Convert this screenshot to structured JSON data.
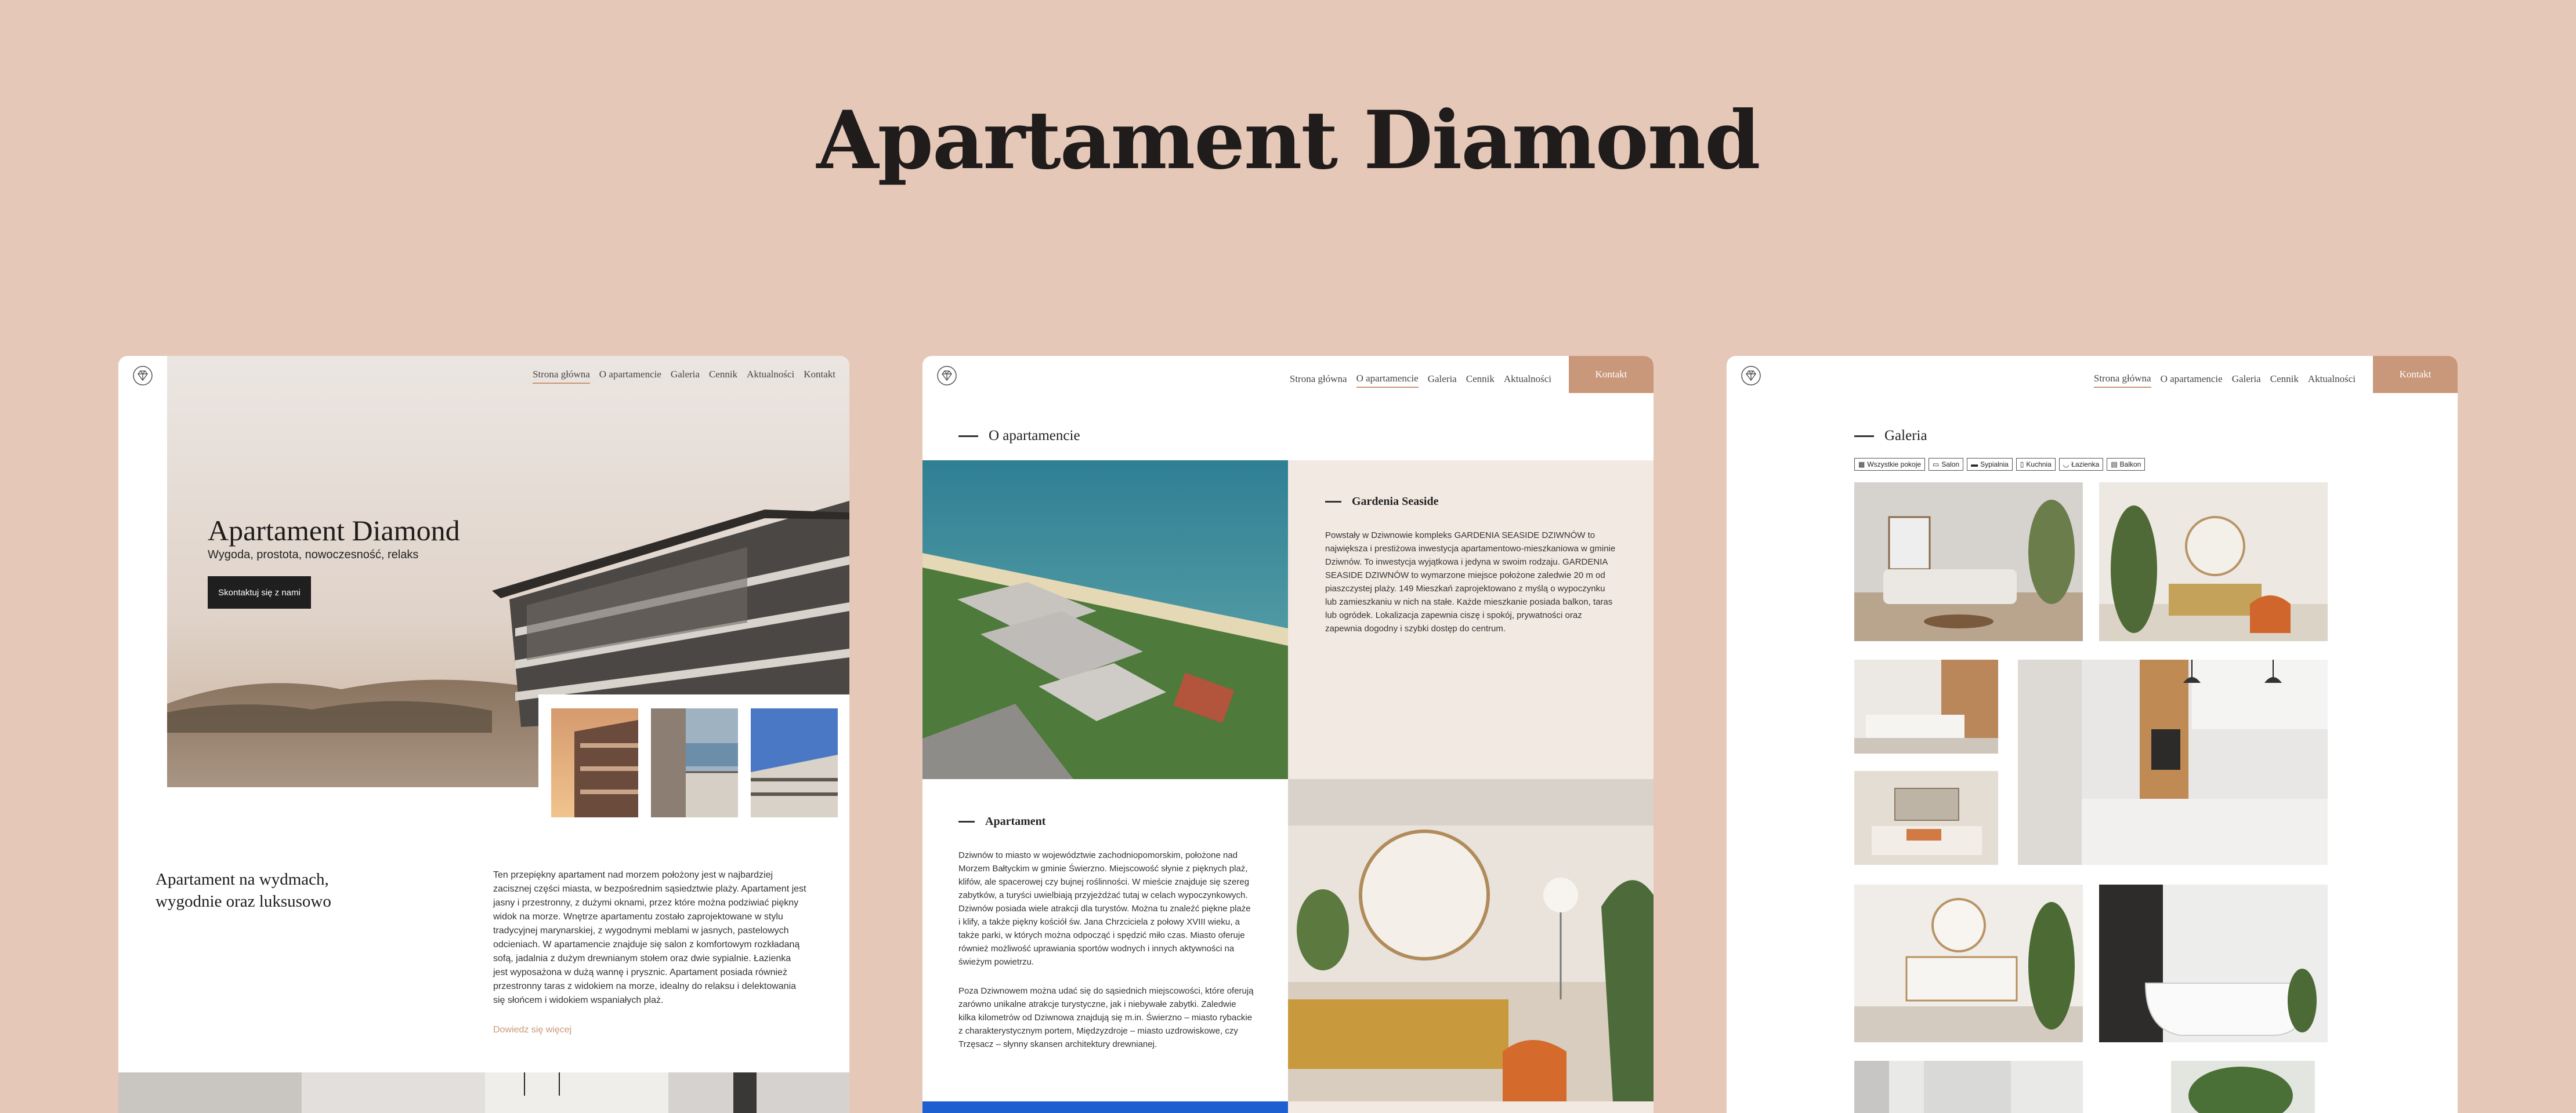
{
  "page": {
    "title": "Apartament Diamond"
  },
  "colors": {
    "background": "#e6c8b9",
    "accent": "#c9987a",
    "dark_button": "#1f1f1f",
    "beige_panel": "#f3e9e3"
  },
  "nav": {
    "home": "Strona główna",
    "about": "O apartamencie",
    "gallery": "Galeria",
    "pricing": "Cennik",
    "news": "Aktualności",
    "contact": "Kontakt"
  },
  "card1": {
    "hero_title": "Apartament Diamond",
    "hero_subtitle": "Wygoda, prostota, nowoczesność, relaks",
    "cta": "Skontaktuj się z nami",
    "section_title_line1": "Apartament na wydmach,",
    "section_title_line2": "wygodnie oraz luksusowo",
    "body": "Ten przepiękny apartament nad morzem położony jest w najbardziej zacisznej części miasta, w bezpośrednim sąsiedztwie plaży. Apartament jest jasny i przestronny, z dużymi oknami, przez które można podziwiać piękny widok na morze. Wnętrze apartamentu zostało zaprojektowane w stylu tradycyjnej marynarskiej, z wygodnymi meblami w jasnych, pastelowych odcieniach. W apartamencie znajduje się salon z komfortowym rozkładaną sofą, jadalnia z dużym drewnianym stołem oraz dwie sypialnie. Łazienka jest wyposażona w dużą wannę i prysznic. Apartament posiada również przestronny taras z widokiem na morze, idealny do relaksu i delektowania się słońcem i widokiem wspaniałych plaż.",
    "read_more": "Dowiedz się więcej"
  },
  "card2": {
    "section_title": "O apartamencie",
    "gardenia_title": "Gardenia Seaside",
    "gardenia_body": "Powstały w Dziwnowie kompleks GARDENIA SEASIDE DZIWNÓW to największa i prestiżowa inwestycja apartamentowo-mieszkaniowa w gminie Dziwnów. To inwestycja wyjątkowa i jedyna w swoim rodzaju. GARDENIA SEASIDE DZIWNÓW to wymarzone miejsce położone zaledwie 20 m od piaszczystej plaży. 149 Mieszkań zaprojektowano z myślą o wypoczynku lub zamieszkaniu w nich na stałe. Każde mieszkanie posiada balkon, taras lub ogródek. Lokalizacja zapewnia ciszę i spokój, prywatności oraz zapewnia dogodny i szybki dostęp do centrum.",
    "apartment_title": "Apartament",
    "apartment_body1": "Dziwnów to miasto w województwie zachodniopomorskim, położone nad Morzem Bałtyckim w gminie Świerzno. Miejscowość słynie z pięknych plaż, klifów, ale spacerowej czy bujnej roślinności. W mieście znajduje się szereg zabytków, a turyści uwielbiają przyjeżdżać tutaj w celach wypoczynkowych. Dziwnów posiada wiele atrakcji dla turystów. Można tu znaleźć piękne plaże i klify, a także piękny kościół św. Jana Chrzciciela z połowy XVIII wieku, a także parki, w których można odpocząć i spędzić miło czas. Miasto oferuje również możliwość uprawiania sportów wodnych i innych aktywności na świeżym powietrzu.",
    "apartment_body2": "Poza Dziwnowem można udać się do sąsiednich miejscowości, które oferują zarówno unikalne atrakcje turystyczne, jak i niebywałe zabytki. Zaledwie kilka kilometrów od Dziwnowa znajdują się m.in. Świerzno – miasto rybackie z charakterystycznym portem, Międzyzdroje – miasto uzdrowiskowe, czy Trzęsacz – słynny skansen architektury drewnianej."
  },
  "card3": {
    "section_title": "Galeria",
    "filters": [
      "Wszystkie pokoje",
      "Salon",
      "Sypialnia",
      "Kuchnia",
      "Łazienka",
      "Balkon"
    ]
  }
}
